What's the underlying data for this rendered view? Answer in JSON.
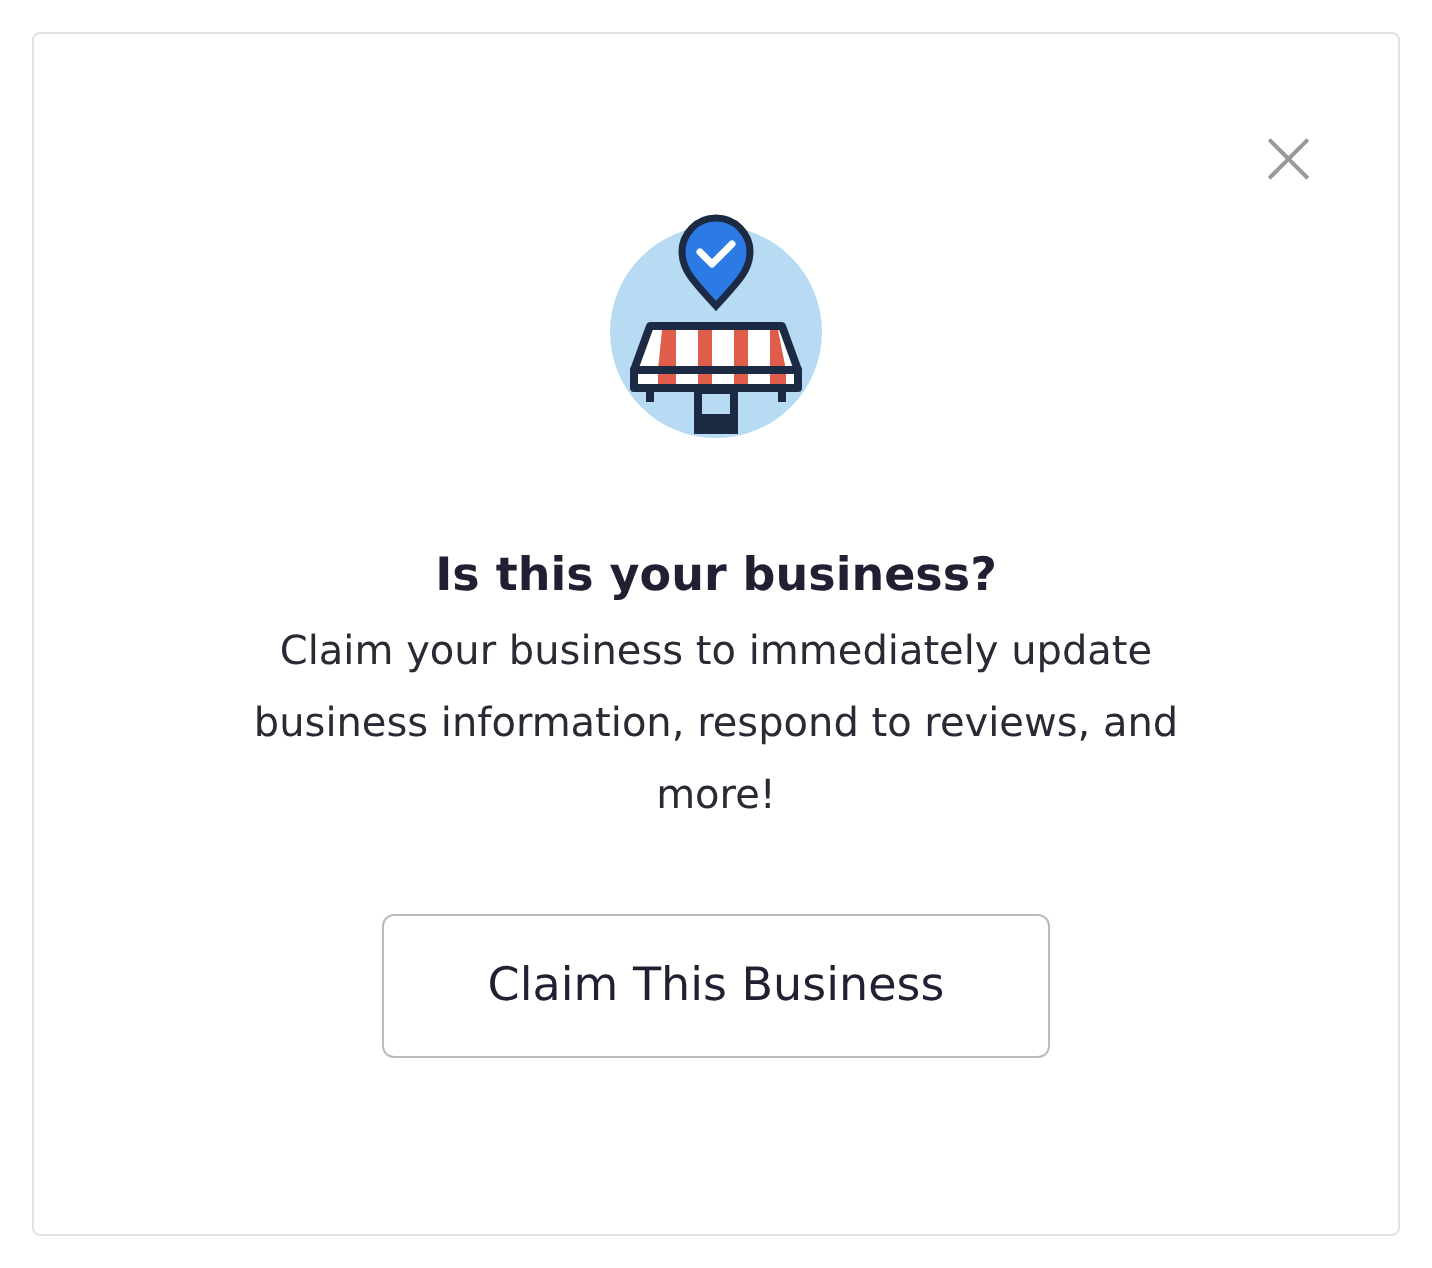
{
  "dialog": {
    "close_label": "×",
    "title": "Is this your business?",
    "message": "Claim your business to immediately update business information, respond to reviews, and more!",
    "button": "Claim This Business"
  }
}
